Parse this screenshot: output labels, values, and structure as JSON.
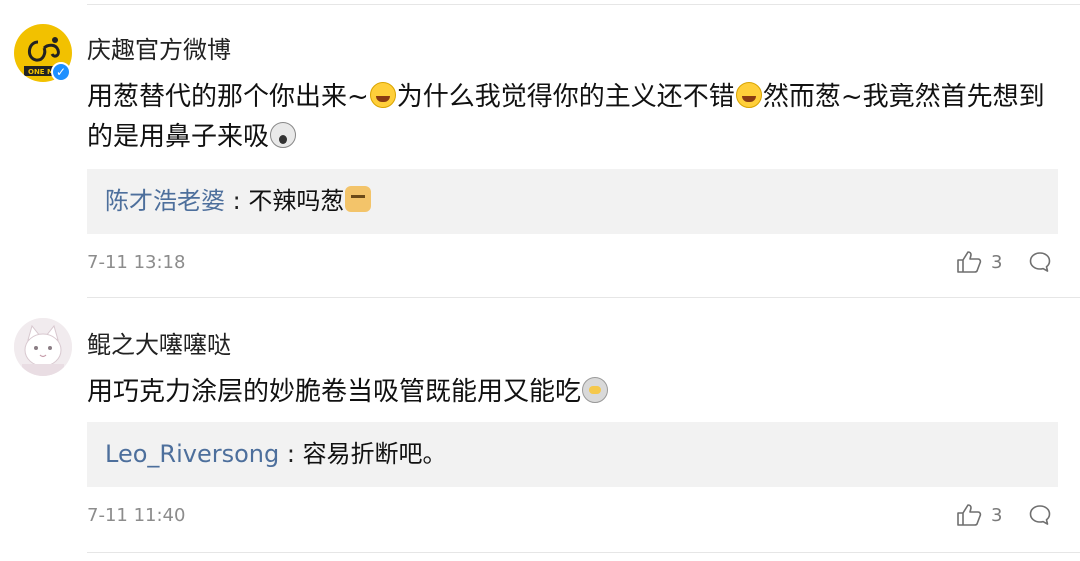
{
  "comments": [
    {
      "username": "庆趣官方微博",
      "avatar_text": "ONE M",
      "verified": true,
      "text_parts": [
        "用葱替代的那个你出来~",
        "为什么我觉得你的主义还不错",
        "然而葱~我竟然首先想到的是用鼻子来吸"
      ],
      "reply": {
        "user": "陈才浩老婆",
        "separator": " : ",
        "text": "不辣吗葱"
      },
      "time": "7-11 13:18",
      "likes": "3"
    },
    {
      "username": "鲲之大噻噻哒",
      "text_parts": [
        "用巧克力涂层的妙脆卷当吸管既能用又能吃"
      ],
      "reply": {
        "user": "Leo_Riversong",
        "separator": " : ",
        "text": "容易折断吧。"
      },
      "time": "7-11 11:40",
      "likes": "3"
    }
  ],
  "colors": {
    "reply_user": "#4d6f9c",
    "reply_bg": "#f2f2f2",
    "verified_badge": "#1e90ff",
    "meta_text": "#8c8c8c"
  },
  "icons": [
    "verified-badge-icon",
    "laugh-cry-emoji",
    "shocked-emoji",
    "doge-emoji",
    "ultraman-emoji",
    "thumbs-up-icon",
    "comment-bubble-icon"
  ]
}
